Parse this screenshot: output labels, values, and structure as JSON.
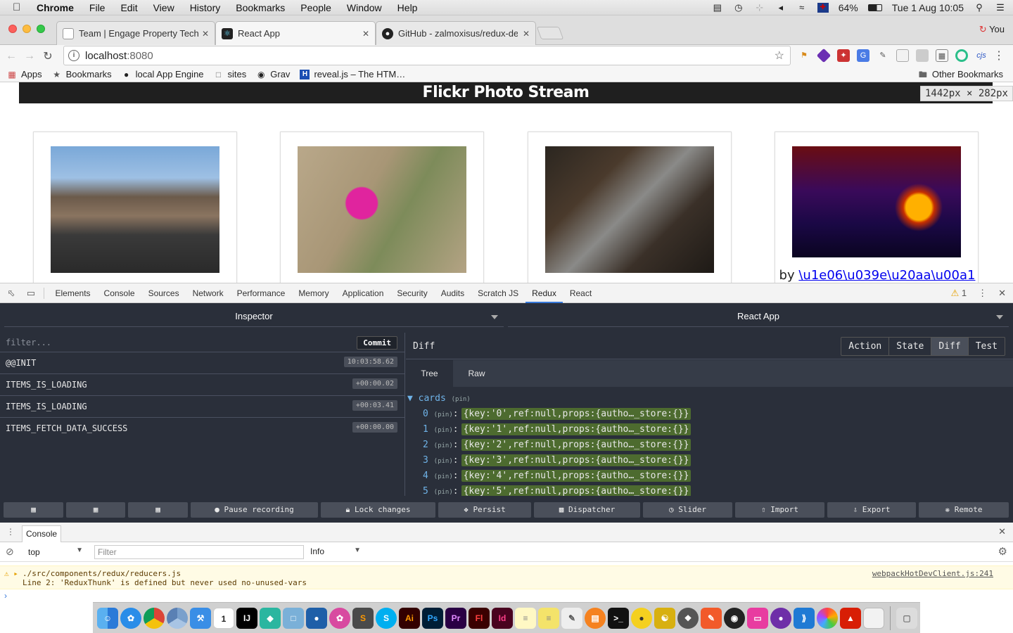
{
  "menubar": {
    "app": "Chrome",
    "items": [
      "File",
      "Edit",
      "View",
      "History",
      "Bookmarks",
      "People",
      "Window",
      "Help"
    ],
    "battery": "64%",
    "clock": "Tue 1 Aug  10:05"
  },
  "tabs": [
    {
      "label": "Team | Engage Property Techn"
    },
    {
      "label": "React App"
    },
    {
      "label": "GitHub - zalmoxisus/redux-dev"
    }
  ],
  "profile": "You",
  "address": {
    "host": "localhost",
    "port": ":8080"
  },
  "bookmarks": [
    {
      "label": "Apps",
      "icon": "apps-grid-icon"
    },
    {
      "label": "Bookmarks",
      "icon": "star-icon"
    },
    {
      "label": "local App Engine",
      "icon": "github-icon"
    },
    {
      "label": "sites",
      "icon": "page-icon"
    },
    {
      "label": "Grav",
      "icon": "grav-icon"
    },
    {
      "label": "reveal.js – The HTM…",
      "icon": "h-icon"
    }
  ],
  "other_bookmarks": "Other Bookmarks",
  "page": {
    "title": "Flickr Photo Stream",
    "dims": "1442px × 282px",
    "card4_by": "by",
    "card4_author": "\\u1e06\\u039e\\u20aa\\u00a1"
  },
  "devtools": {
    "tabs": [
      "Elements",
      "Console",
      "Sources",
      "Network",
      "Performance",
      "Memory",
      "Application",
      "Security",
      "Audits",
      "Scratch JS",
      "Redux",
      "React"
    ],
    "warn_count": "1"
  },
  "redux": {
    "left_title": "Inspector",
    "right_title": "React App",
    "filter_placeholder": "filter...",
    "commit": "Commit",
    "actions": [
      {
        "name": "@@INIT",
        "time": "10:03:58.62"
      },
      {
        "name": "ITEMS_IS_LOADING",
        "time": "+00:00.02"
      },
      {
        "name": "ITEMS_IS_LOADING",
        "time": "+00:03.41"
      },
      {
        "name": "ITEMS_FETCH_DATA_SUCCESS",
        "time": "+00:00.00"
      }
    ],
    "diff_label": "Diff",
    "modes": [
      "Action",
      "State",
      "Diff",
      "Test"
    ],
    "subtabs": [
      "Tree",
      "Raw"
    ],
    "tree_root": "cards",
    "pin": "(pin)",
    "tree_rows": [
      {
        "k": "0",
        "v": "{key:'0',ref:null,props:{autho…_store:{}}"
      },
      {
        "k": "1",
        "v": "{key:'1',ref:null,props:{autho…_store:{}}"
      },
      {
        "k": "2",
        "v": "{key:'2',ref:null,props:{autho…_store:{}}"
      },
      {
        "k": "3",
        "v": "{key:'3',ref:null,props:{autho…_store:{}}"
      },
      {
        "k": "4",
        "v": "{key:'4',ref:null,props:{autho…_store:{}}"
      },
      {
        "k": "5",
        "v": "{key:'5',ref:null,props:{autho…_store:{}}"
      }
    ],
    "buttons": [
      "Pause recording",
      "Lock changes",
      "Persist",
      "Dispatcher",
      "Slider",
      "Import",
      "Export",
      "Remote"
    ]
  },
  "console": {
    "tab": "Console",
    "context": "top",
    "filter_placeholder": "Filter",
    "level": "Info",
    "warn_line1": "./src/components/redux/reducers.js",
    "warn_line2": "Line 2:  'ReduxThunk' is defined but never used  no-unused-vars",
    "warn_source": "webpackHotDevClient.js:241"
  }
}
